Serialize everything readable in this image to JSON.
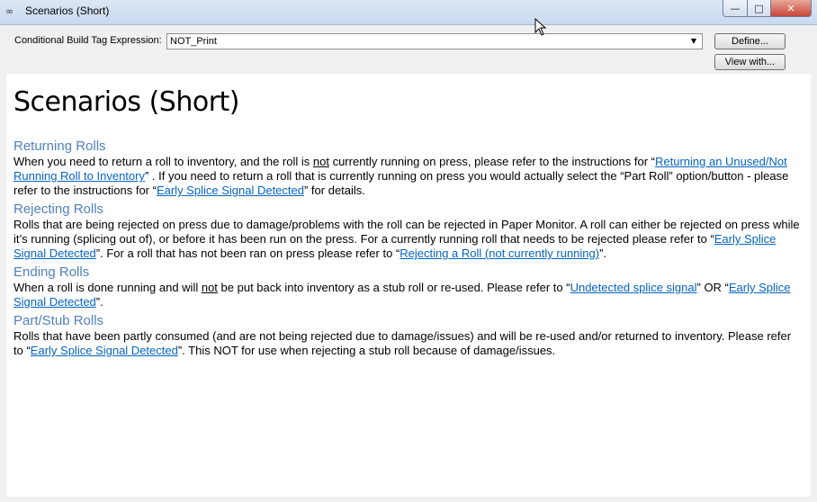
{
  "window": {
    "title": "Scenarios (Short)",
    "icon": "binoculars-icon",
    "buttons": {
      "minimize": "minimize",
      "maximize": "maximize",
      "close": "close"
    }
  },
  "toolbar": {
    "cbt_label": "Conditional Build Tag Expression:",
    "cbt_value": "NOT_Print",
    "define_label": "Define...",
    "view_label": "View with..."
  },
  "page": {
    "title": "Scenarios (Short)",
    "sections": [
      {
        "heading": "Returning Rolls",
        "parts": [
          {
            "t": "text",
            "v": "When you need to return a roll to inventory, and the roll is "
          },
          {
            "t": "u",
            "v": "not"
          },
          {
            "t": "text",
            "v": " currently running on press, please refer to the instructions for “"
          },
          {
            "t": "link",
            "v": "Returning an Unused/Not Running Roll to Inventory"
          },
          {
            "t": "text",
            "v": "” .  If you need to return a roll that is currently running on press you would actually select the “Part Roll” option/button - please refer to the instructions for “"
          },
          {
            "t": "link",
            "v": "Early Splice Signal Detected"
          },
          {
            "t": "text",
            "v": "” for details."
          }
        ]
      },
      {
        "heading": "Rejecting Rolls",
        "parts": [
          {
            "t": "text",
            "v": "Rolls that are being rejected on press due to damage/problems with the roll can be rejected in Paper Monitor.  A roll can either be rejected on press while it’s running (splicing out of), or before it has been run on the press.  For a currently running roll that needs to be rejected please refer to “"
          },
          {
            "t": "link",
            "v": "Early Splice Signal Detected"
          },
          {
            "t": "text",
            "v": "”.  For a roll that has not been ran on press please refer to “"
          },
          {
            "t": "link",
            "v": "Rejecting a Roll (not currently running)"
          },
          {
            "t": "text",
            "v": "”."
          }
        ]
      },
      {
        "heading": "Ending Rolls",
        "parts": [
          {
            "t": "text",
            "v": "When a roll is done running and will "
          },
          {
            "t": "u",
            "v": "not"
          },
          {
            "t": "text",
            "v": " be put back into inventory as a stub roll or re-used.  Please refer to “"
          },
          {
            "t": "link",
            "v": "Undetected splice signal"
          },
          {
            "t": "text",
            "v": "” OR “"
          },
          {
            "t": "link",
            "v": "Early Splice Signal Detected"
          },
          {
            "t": "text",
            "v": "”."
          }
        ]
      },
      {
        "heading": "Part/Stub Rolls",
        "parts": [
          {
            "t": "text",
            "v": "Rolls that have been partly consumed (and are not being rejected due to damage/issues) and will be re-used and/or returned to inventory.  Please refer to “"
          },
          {
            "t": "link",
            "v": "Early Splice Signal Detected"
          },
          {
            "t": "text",
            "v": "”.  This NOT for use when rejecting a stub roll because of damage/issues."
          }
        ]
      }
    ]
  },
  "colors": {
    "heading": "#4f81bd",
    "link": "#0563c1",
    "close_button": "#c7463a"
  }
}
